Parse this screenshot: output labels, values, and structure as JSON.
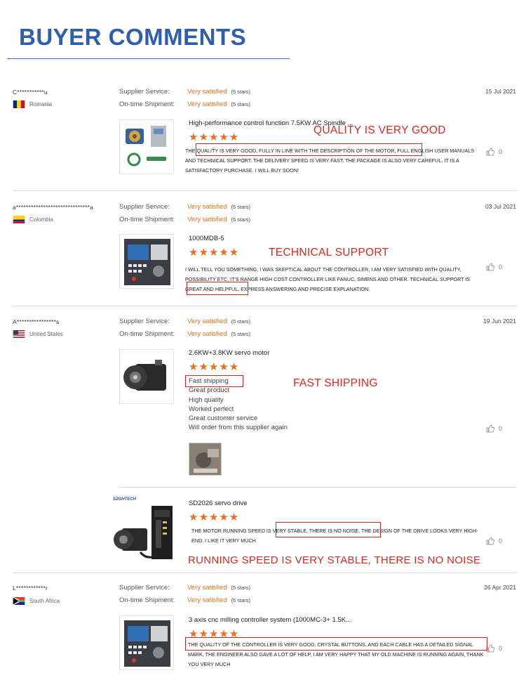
{
  "header": {
    "title": "BUYER COMMENTS"
  },
  "labels": {
    "supplier_service": "Supplier Service:",
    "ontime_shipment": "On-time Shipment:",
    "very_satisfied": "Very satisfied",
    "five_stars": "(5 stars)"
  },
  "colors": {
    "title": "#2e5fae",
    "rating_value": "#e8701a",
    "stars": "#ef6c1e",
    "annotation": "#e0261c"
  },
  "reviews": [
    {
      "user": "C***********u",
      "country": "Romania",
      "date": "15 Jul 2021",
      "product": "High-performance control function 7.5KW AC Spindle ...",
      "stars": "★★★★★",
      "text": "THE QUALITY IS VERY GOOD, FULLY IN LINE WITH THE DESCRIPTION OF THE MOTOR, FULL ENGLISH USER MANUALS AND TECHNICAL SUPPORT.  THE DELIVERY SPEED IS VERY FAST, THE PACKAGE IS ALSO VERY CAREFUL, IT IS A SATISFACTORY PURCHASE. I WILL BUY SOON!",
      "likes": "0",
      "annotation": "QUALITY IS VERY GOOD"
    },
    {
      "user": "a******************************a",
      "country": "Colombia",
      "date": "03 Jul 2021",
      "product": "1000MDB-5",
      "stars": "★★★★★",
      "text": "I WILL TELL YOU SOMETHING, I WAS SKEPTICAL ABOUT THE CONTROLLER, I AM VERY SATISFIED WITH QUALITY, POSSIBILITY ETC, IT'S RANGE HIGH COST CONTROLLER LIKE FANUC, SIMENS AND OTHER. TECHNICAL SUPPORT IS GREAT AND HELPFUL, EXPRESS ANSWERING AND PRECISE EXPLANATION.",
      "likes": "0",
      "annotation": "TECHNICAL SUPPORT"
    },
    {
      "user": "A****************s",
      "country": "United States",
      "date": "19 Jun 2021",
      "product": "2.6KW+3.8KW servo motor",
      "stars": "★★★★★",
      "lines": [
        "Fast shipping",
        "Great product",
        "High quality",
        "Worked perfect",
        "Great customer service",
        "Will order from this supplier again"
      ],
      "likes": "0",
      "annotation": "FAST SHIPPING"
    },
    {
      "brand": "SZGHTECH",
      "product": "SD2026 servo drive",
      "stars": "★★★★★",
      "text": "THE MOTOR RUNNING SPEED IS VERY STABLE, THERE IS NO NOISE, THE DESIGN OF THE DRIVE LOOKS VERY HIGH-END, I LIKE IT VERY MUCH",
      "likes": "0",
      "annotation": "RUNNING SPEED IS VERY STABLE, THERE IS NO NOISE"
    },
    {
      "user": "L************r",
      "country": "South Africa",
      "date": "26 Apr 2021",
      "product": "3 axis cnc milling controller system (1000MC-3+ 1.5K...",
      "stars": "★★★★★",
      "text": "THE QUALITY OF THE CONTROLLER IS VERY GOOD, CRYSTAL BUTTONS, AND EACH CABLE HAS A DETAILED  SIGNAL MARK, THE ENGINEER ALSO GAVE A LOT OF HELP, I AM VERY HAPPY THAT MY OLD MACHINE IS RUNNING AGAIN, THANK YOU VERY MUCH",
      "likes": "0"
    }
  ]
}
